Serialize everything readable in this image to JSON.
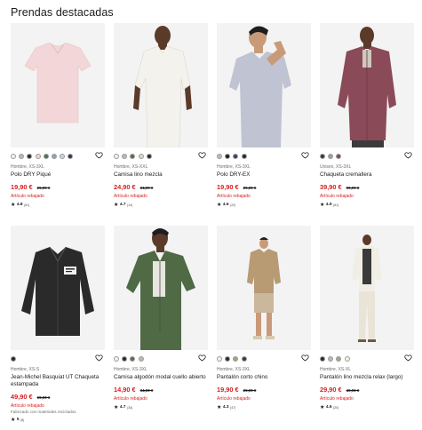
{
  "section_title": "Prendas destacadas",
  "products": [
    {
      "swatches": [
        "#f4f1ea",
        "#b9b9b9",
        "#2d2d2d",
        "#f2d3d5",
        "#5a6e4e",
        "#8aa3c4",
        "#c9d2ea",
        "#2f3a57"
      ],
      "gender_size": "Hombre, XS-3XL",
      "name": "Polo DRY Piqué",
      "price": "19,90 €",
      "old_price": "29,90 €",
      "flag": "Artículo rebajado",
      "note": "",
      "rating": "4.8",
      "reviews": "(61)",
      "heart_icon": "heart-outline-icon",
      "photo": {
        "bg": "#f3f3f3",
        "garment": "#f3d6d8"
      }
    },
    {
      "swatches": [
        "#f4f1ea",
        "#b9b9b9",
        "#5a6e4e",
        "#d9d6cf",
        "#2d2d2d"
      ],
      "gender_size": "Hombre, XS-XXL",
      "name": "Camisa lino mezcla",
      "price": "24,90 €",
      "old_price": "34,90 €",
      "flag": "Artículo rebajado",
      "note": "",
      "rating": "4.7",
      "reviews": "(14)",
      "heart_icon": "heart-outline-icon",
      "photo": {
        "bg": "#f3f3f3",
        "garment": "#f4f2ec"
      }
    },
    {
      "swatches": [
        "#b8bcc8",
        "#1f1f1f",
        "#3a3f6b",
        "#2d2d2d"
      ],
      "gender_size": "Hombre, XS-3XL",
      "name": "Polo DRY-EX",
      "price": "19,90 €",
      "old_price": "29,90 €",
      "flag": "Artículo rebajado",
      "note": "",
      "rating": "4.6",
      "reviews": "(22)",
      "heart_icon": "heart-outline-icon",
      "photo": {
        "bg": "#f3f3f3",
        "garment": "#bfc3d2"
      }
    },
    {
      "swatches": [
        "#3b3b3b",
        "#a8a08a",
        "#8a4a58"
      ],
      "gender_size": "Unisex, XS-3XL",
      "name": "Chaqueta cremallera",
      "price": "39,90 €",
      "old_price": "59,90 €",
      "flag": "Artículo rebajado",
      "note": "",
      "rating": "4.9",
      "reviews": "(61)",
      "heart_icon": "heart-outline-icon",
      "photo": {
        "bg": "#f3f3f3",
        "garment": "#8a4a58"
      }
    },
    {
      "swatches": [
        "#2d2d2d"
      ],
      "gender_size": "Hombre, XS-S",
      "name": "Jean-Michel Basquiat UT Chaqueta estampada",
      "price": "49,90 €",
      "old_price": "69,90 €",
      "flag": "Artículo rebajado",
      "note": "Fabricado con materiales reciclados",
      "rating": "5",
      "reviews": "(8)",
      "heart_icon": "heart-outline-icon",
      "photo": {
        "bg": "#f3f3f3",
        "garment": "#2a2a2a"
      }
    },
    {
      "swatches": [
        "#f4f1ea",
        "#2d2d2d",
        "#5a6e4e",
        "#b9b9b9"
      ],
      "gender_size": "Hombre, XS-3XL",
      "name": "Camisa algodón modal cuello abierto",
      "price": "14,90 €",
      "old_price": "34,90 €",
      "flag": "Artículo rebajado",
      "note": "",
      "rating": "4.7",
      "reviews": "(34)",
      "heart_icon": "heart-outline-icon",
      "photo": {
        "bg": "#f3f3f3",
        "garment": "#4f6a45"
      }
    },
    {
      "swatches": [
        "#f4f1ea",
        "#2d2d2d",
        "#a8a08a",
        "#3b3b3b"
      ],
      "gender_size": "Hombre, XS-3XL",
      "name": "Pantalón corto chino",
      "price": "19,90 €",
      "old_price": "29,90 €",
      "flag": "Artículo rebajado",
      "note": "",
      "rating": "4.3",
      "reviews": "(47)",
      "heart_icon": "heart-outline-icon",
      "photo": {
        "bg": "#f3f3f3",
        "garment": "#cbb79b"
      }
    },
    {
      "swatches": [
        "#2d2d2d",
        "#b9b9b9",
        "#a8a08a",
        "#f4f1ea"
      ],
      "gender_size": "Hombre, XS-XL",
      "name": "Pantalón lino mezcla relax (largo)",
      "price": "29,90 €",
      "old_price": "49,90 €",
      "flag": "Artículo rebajado",
      "note": "",
      "rating": "4.6",
      "reviews": "(20)",
      "heart_icon": "heart-outline-icon",
      "photo": {
        "bg": "#f3f3f3",
        "garment": "#e9e4d6"
      }
    }
  ]
}
